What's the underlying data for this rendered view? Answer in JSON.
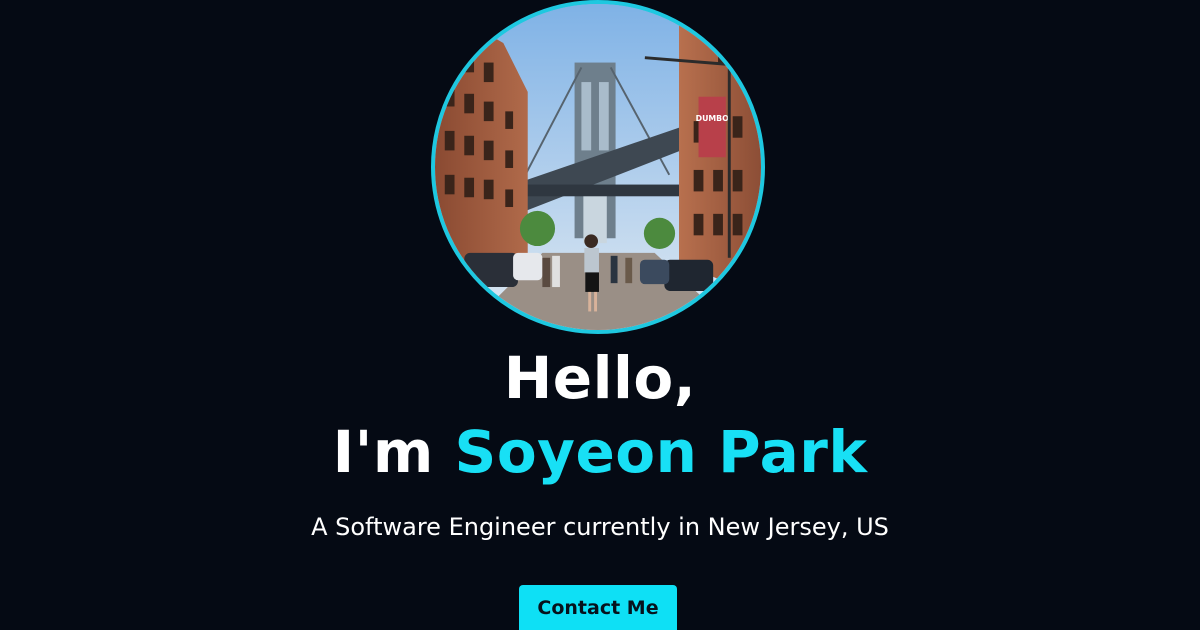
{
  "hero": {
    "greeting": "Hello,",
    "intro_prefix": "I'm ",
    "name": "Soyeon Park",
    "subtitle": "A Software Engineer currently in New Jersey, US",
    "cta_label": "Contact Me"
  },
  "photo": {
    "banner_text": "DUMBO"
  },
  "colors": {
    "background": "#050a14",
    "accent": "#18e0f5",
    "avatar_border": "#1ec8e0",
    "button_bg": "#0ee0f5"
  }
}
